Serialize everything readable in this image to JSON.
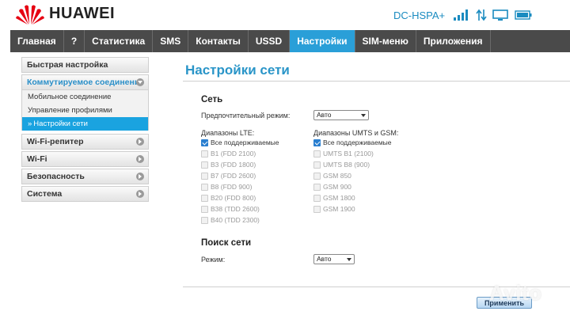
{
  "header": {
    "brand": "HUAWEI",
    "network_type": "DC-HSPA+",
    "accent_color": "#2a9fd8"
  },
  "nav": {
    "items": [
      {
        "label": "Главная",
        "active": false
      },
      {
        "label": "?",
        "active": false
      },
      {
        "label": "Статистика",
        "active": false
      },
      {
        "label": "SMS",
        "active": false
      },
      {
        "label": "Контакты",
        "active": false
      },
      {
        "label": "USSD",
        "active": false
      },
      {
        "label": "Настройки",
        "active": true
      },
      {
        "label": "SIM-меню",
        "active": false
      },
      {
        "label": "Приложения",
        "active": false
      }
    ]
  },
  "sidebar": {
    "quick_setup": "Быстрая настройка",
    "dialup": "Коммутируемое соединение",
    "dialup_items": [
      "Мобильное соединение",
      "Управление профилями",
      "Настройки сети"
    ],
    "wifi_repeater": "Wi-Fi-репитер",
    "wifi": "Wi-Fi",
    "security": "Безопасность",
    "system": "Система"
  },
  "main": {
    "title": "Настройки сети",
    "network": {
      "title": "Сеть",
      "preferred_mode_label": "Предпочтительный режим:",
      "preferred_mode_value": "Авто",
      "lte_label": "Диапазоны LTE:",
      "umts_gsm_label": "Диапазоны UMTS и GSM:",
      "lte_bands": [
        {
          "label": "Все поддерживаемые",
          "checked": true
        },
        {
          "label": "B1 (FDD 2100)",
          "checked": false
        },
        {
          "label": "B3 (FDD 1800)",
          "checked": false
        },
        {
          "label": "B7 (FDD 2600)",
          "checked": false
        },
        {
          "label": "B8 (FDD 900)",
          "checked": false
        },
        {
          "label": "B20 (FDD 800)",
          "checked": false
        },
        {
          "label": "B38 (TDD 2600)",
          "checked": false
        },
        {
          "label": "B40 (TDD 2300)",
          "checked": false
        }
      ],
      "umts_gsm_bands": [
        {
          "label": "Все поддерживаемые",
          "checked": true
        },
        {
          "label": "UMTS B1 (2100)",
          "checked": false
        },
        {
          "label": "UMTS B8 (900)",
          "checked": false
        },
        {
          "label": "GSM 850",
          "checked": false
        },
        {
          "label": "GSM 900",
          "checked": false
        },
        {
          "label": "GSM 1800",
          "checked": false
        },
        {
          "label": "GSM 1900",
          "checked": false
        }
      ]
    },
    "search": {
      "title": "Поиск сети",
      "mode_label": "Режим:",
      "mode_value": "Авто"
    },
    "apply_label": "Применить"
  },
  "watermark": "Avito"
}
